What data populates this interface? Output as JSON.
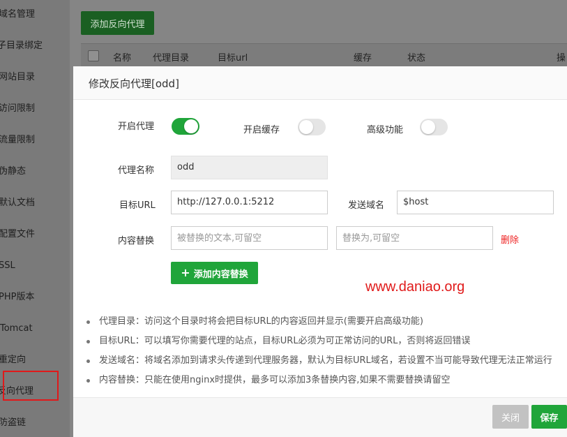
{
  "sidebar": {
    "items": [
      {
        "label": "域名管理"
      },
      {
        "label": "子目录绑定"
      },
      {
        "label": "网站目录"
      },
      {
        "label": "访问限制"
      },
      {
        "label": "流量限制"
      },
      {
        "label": "伪静态"
      },
      {
        "label": "默认文档"
      },
      {
        "label": "配置文件"
      },
      {
        "label": "SSL"
      },
      {
        "label": "PHP版本"
      },
      {
        "label": "Tomcat"
      },
      {
        "label": "重定向"
      },
      {
        "label": "反向代理"
      },
      {
        "label": "防盗链"
      }
    ]
  },
  "background": {
    "add_proxy_label": "添加反向代理",
    "table_headers": [
      "名称",
      "代理目录",
      "目标url",
      "缓存",
      "状态",
      "操"
    ]
  },
  "modal": {
    "title": "修改反向代理[odd]",
    "toggles": {
      "enable_proxy": {
        "label": "开启代理",
        "state": "on"
      },
      "enable_cache": {
        "label": "开启缓存",
        "state": "off"
      },
      "advanced": {
        "label": "高级功能",
        "state": "off"
      }
    },
    "fields": {
      "proxy_name": {
        "label": "代理名称",
        "value": "odd"
      },
      "target_url": {
        "label": "目标URL",
        "value": "http://127.0.0.1:5212"
      },
      "send_domain": {
        "label": "发送域名",
        "value": "$host"
      },
      "content_replace": {
        "label": "内容替换",
        "from_placeholder": "被替换的文本,可留空",
        "to_placeholder": "替换为,可留空",
        "delete_label": "删除"
      }
    },
    "add_replace_label": "添加内容替换",
    "watermark": "www.daniao.org",
    "tips": [
      "代理目录：访问这个目录时将会把目标URL的内容返回并显示(需要开启高级功能)",
      "目标URL：可以填写你需要代理的站点，目标URL必须为可正常访问的URL，否则将返回错误",
      "发送域名：将域名添加到请求头传递到代理服务器，默认为目标URL域名，若设置不当可能导致代理无法正常运行",
      "内容替换：只能在使用nginx时提供，最多可以添加3条替换内容,如果不需要替换请留空"
    ],
    "footer": {
      "close_label": "关闭",
      "save_label": "保存"
    }
  },
  "colors": {
    "accent": "#20a53a",
    "danger": "#e22222",
    "annotation": "#e0191a"
  }
}
